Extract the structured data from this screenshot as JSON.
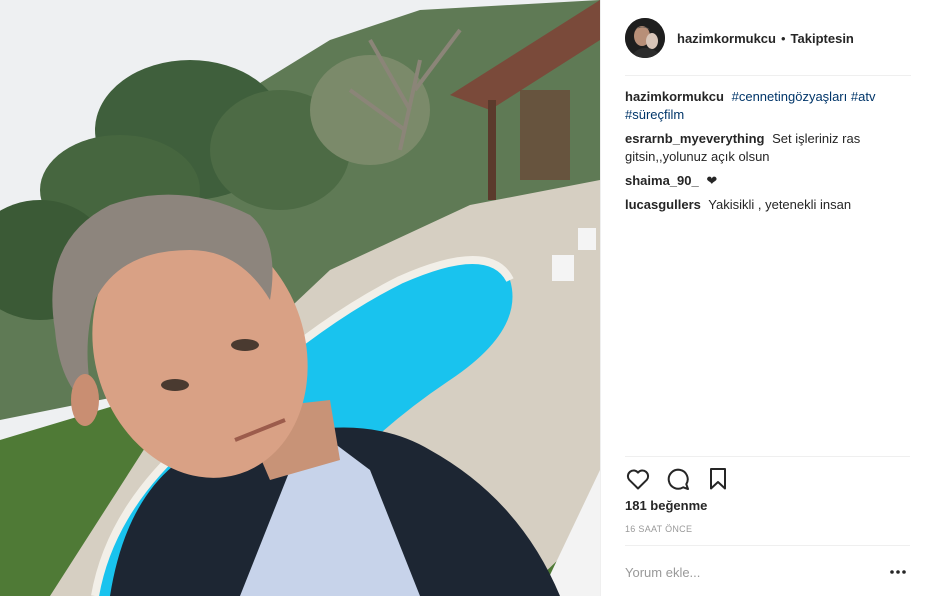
{
  "header": {
    "username": "hazimkormukcu",
    "separator": "•",
    "follow_status": "Takiptesin"
  },
  "caption": {
    "username": "hazimkormukcu",
    "hashtags": [
      "#cennetingözyaşları",
      "#atv",
      "#süreçfilm"
    ]
  },
  "comments": [
    {
      "username": "esrarnb_myeverything",
      "text": "Set işleriniz ras gitsin,,yolunuz açık olsun"
    },
    {
      "username": "shaima_90_",
      "text": "❤"
    },
    {
      "username": "lucasgullers",
      "text": "Yakisikli , yetenekli insan"
    }
  ],
  "actions": {
    "like_icon": "heart-icon",
    "comment_icon": "speech-bubble-icon",
    "save_icon": "bookmark-icon"
  },
  "likes_text": "181 beğenme",
  "timestamp": "16 SAAT ÖNCE",
  "comment_input": {
    "placeholder": "Yorum ekle...",
    "value": ""
  },
  "colors": {
    "text": "#262626",
    "hashtag": "#003569",
    "muted": "#999999",
    "divider": "#efefef",
    "pool": "#19c3ee"
  }
}
